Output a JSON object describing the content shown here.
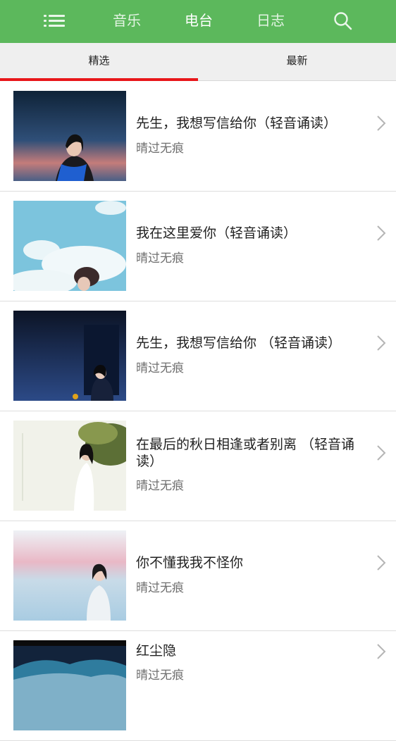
{
  "header": {
    "menu_icon": "list-icon",
    "nav": [
      "音乐",
      "电台",
      "日志"
    ],
    "active": "电台",
    "search_icon": "search-icon",
    "bg_color": "#5cb85c"
  },
  "tabs": {
    "items": [
      "精选",
      "最新"
    ],
    "active": "精选",
    "indicator_color": "#e8161a"
  },
  "items": [
    {
      "title": "先生，我想写信给你（轻音诵读）",
      "author": "晴过无痕"
    },
    {
      "title": "我在这里爱你（轻音诵读）",
      "author": "晴过无痕"
    },
    {
      "title": "先生，我想写信给你 （轻音诵读）",
      "author": "晴过无痕"
    },
    {
      "title": "在最后的秋日相逢或者别离 （轻音诵读）",
      "author": "晴过无痕"
    },
    {
      "title": "你不懂我我不怪你",
      "author": "晴过无痕"
    },
    {
      "title": "红尘隐",
      "author": "晴过无痕"
    }
  ]
}
